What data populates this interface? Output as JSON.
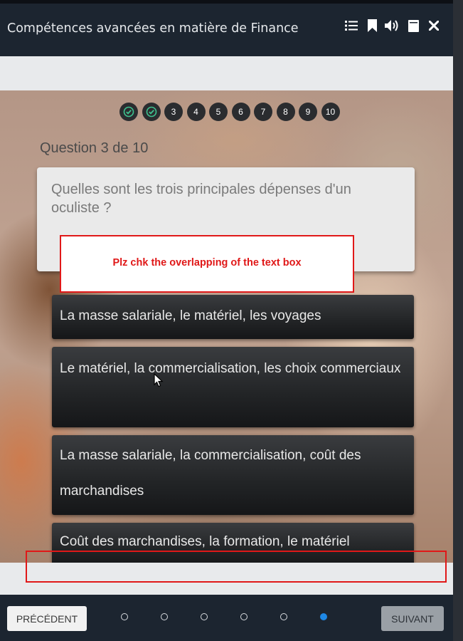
{
  "header": {
    "title": "Compétences avancées en matière de Finance",
    "icons": [
      "list-icon",
      "bookmark-icon",
      "volume-icon",
      "notes-icon",
      "close-icon"
    ]
  },
  "progress": {
    "items": [
      {
        "label": "",
        "state": "done"
      },
      {
        "label": "",
        "state": "done"
      },
      {
        "label": "3",
        "state": "current"
      },
      {
        "label": "4",
        "state": "pending"
      },
      {
        "label": "5",
        "state": "pending"
      },
      {
        "label": "6",
        "state": "pending"
      },
      {
        "label": "7",
        "state": "pending"
      },
      {
        "label": "8",
        "state": "pending"
      },
      {
        "label": "9",
        "state": "pending"
      },
      {
        "label": "10",
        "state": "pending"
      }
    ]
  },
  "question": {
    "counter": "Question 3 de 10",
    "text": "Quelles sont les trois principales dépenses d'un oculiste ?"
  },
  "answers": [
    {
      "text": "La masse salariale, le matériel, les voyages"
    },
    {
      "text": "Le matériel, la commercialisation, les choix commerciaux"
    },
    {
      "text": "La masse salariale, la commercialisation, coût des marchandises"
    },
    {
      "text": "Coût des marchandises, la formation, le matériel"
    }
  ],
  "annotation": {
    "note": "Plz chk the overlapping of the text box",
    "color": "#e01818"
  },
  "footer": {
    "prev_label": "PRÉCÉDENT",
    "next_label": "SUIVANT",
    "page_dots": 6,
    "active_page": 6
  },
  "colors": {
    "header_bg": "#1c2530",
    "accent_blue": "#1e88e5",
    "check_green": "#3ec28f"
  }
}
